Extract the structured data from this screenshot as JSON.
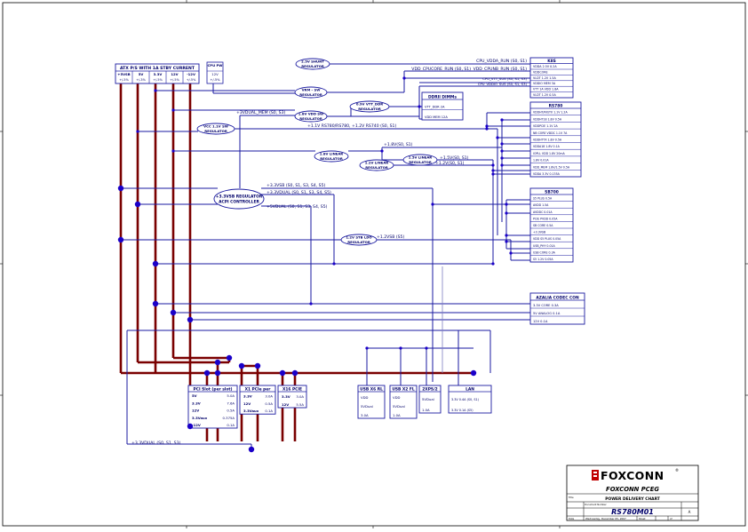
{
  "sheet": {
    "company_name": "FOXCONN",
    "division": "FOXCONN PCEG",
    "title": "POWER DELIVERY CHART",
    "model": "RS780M01",
    "date_text": "Wednesday, December 05, 2007",
    "size_code": "A",
    "label_title": "Title",
    "label_doc": "Document Number",
    "label_date": "Date",
    "label_sheet": "Sheet",
    "label_of": "of"
  },
  "atx": {
    "title": "ATX P/S WITH 1A STBY CURRENT",
    "cols": [
      {
        "name": "+5VSB",
        "tol": "+/-5%"
      },
      {
        "name": "5V",
        "tol": "+/-3%"
      },
      {
        "name": "3.3V",
        "tol": "+/-5%"
      },
      {
        "name": "12V",
        "tol": "+/-5%"
      },
      {
        "name": "-12V",
        "tol": "+/-5%"
      }
    ]
  },
  "cpu_pw": {
    "label": "CPU PW",
    "volt": "12V",
    "tol": "+/-5%"
  },
  "blocks": {
    "shunt": [
      "2.5V SHUNT",
      "REGULATOR"
    ],
    "vrm": [
      "VRM - SW",
      "REGULATOR"
    ],
    "vddr": [
      "1.8V VDD SW",
      "REGULATOR"
    ],
    "vtt": [
      "0.9V VTT_DDR",
      "REGULATOR"
    ],
    "ldo11": [
      "VCC 1.1V SW",
      "REGULATOR"
    ],
    "ldo12a": [
      "1.8V LINEAR",
      "REGULATOR"
    ],
    "ldo12b": [
      "1.2V LINEAR",
      "REGULATOR"
    ],
    "ldo15": [
      "1.5V LINEAR",
      "REGULATOR"
    ],
    "acpi": [
      "+3.3VSB REGULATOR",
      "ACPI CONTROLLER"
    ],
    "stbldo": [
      "1.2V STB LDO",
      "REGULATOR"
    ]
  },
  "ddr": {
    "title": "DDRII DIMMs",
    "rows": [
      "VTT_DDR 2A",
      "VDD MEM 12A"
    ]
  },
  "k8": {
    "title": "K8S",
    "rows": [
      "VDDA 2.5V 0.2A",
      "VDDCORE",
      "VLDT 1.2V 1.5A",
      "VDDIO MEM 3A",
      "VTT 1A VDD 1.8A",
      "VLDT 1.2V 0.5A"
    ]
  },
  "rs780": {
    "title": "RS780",
    "rows": [
      "VDDHT/RX/TX 1.1V 1.2A",
      "VDDHT18 1.8V 0.5A",
      "VDDPCIE 1.1V 2A",
      "NB CORE VDDC 1.1V 7A",
      "VDDHTTX 1.8V 0.5A",
      "VDDA18 1.8V 0.1A",
      "IOPLL VDD 1.8V 20mA",
      "1.8V 0.01A",
      "VDD_MEM 1.8V/1.5V 0.5A",
      "VDDA 3.3V 0.135A"
    ]
  },
  "sb700": {
    "title": "SB700",
    "rows": [
      "S5 PLUS 0.5A",
      "AVDD 1.5A",
      "AVDDC 0.01A",
      "PCIE PVDD 0.05A",
      "SB CORE 0.5A",
      "+3.3VSB",
      "VDD S5 PLUS 0.05A",
      "USB_PHY 0.01A",
      "USB CORE 0.3A",
      "S5 1.2V 0.05A"
    ]
  },
  "azalia": {
    "title": "AZALIA CODEC CON",
    "rows": [
      "3.3V CORE 0.3A",
      "5V ANALOG 0.1A",
      "12V 0.1A"
    ]
  },
  "nets": {
    "cpu_vdda": "CPU_VDDA_RUN (S0, S1)",
    "cpu_core": "VDD_CPUCORE_RUN (S0, S1)",
    "cpu_nb": "VDD_CPUNB_RUN (S0, S1)",
    "cpu_vtt": "CPU_VTT_SUS (S0, S1, S3)",
    "cpu_vddio": "CPU_VDDIO_SUS (S0, S1, S3)",
    "dual_mem": "+3VDUAL_MEM (S0, S3)",
    "rs_11": "+1.1V RS780/RS780, +1.2V RS740 (S0, S1)",
    "v18": "+1.8V(S0, S1)",
    "v15": "+1.5V(S0, S1)",
    "v12": "+1.2V(S0, S1)",
    "v33sb": "+3.3VSB (S0, S1, S3, S4, S5)",
    "v33dual": "+3.3VDUAL (S0, S1, S3, S4, S5)",
    "v5dual": "+5VDUAL (S0, S1, S3, S4, S5)",
    "v12sb": "+1.2VSB (S5)",
    "v33dual_low": "+3.3VDUAL (S0, S1, S3)"
  },
  "slots": {
    "pci": {
      "title": "PCI Slot (per slot)",
      "rows": [
        [
          "5V",
          "5.0A"
        ],
        [
          "3.3V",
          "7.6A"
        ],
        [
          "12V",
          "0.5A"
        ],
        [
          "3.3Vaux",
          "0.375A"
        ],
        [
          "-12V",
          "0.1A"
        ]
      ]
    },
    "x1": {
      "title": "X1 PCIe per",
      "rows": [
        [
          "3.3V",
          "3.0A"
        ],
        [
          "12V",
          "0.5A"
        ],
        [
          "3.3Vaux",
          "0.1A"
        ]
      ]
    },
    "x16": {
      "title": "X16 PCIE",
      "rows": [
        [
          "3.3V",
          "3.0A"
        ],
        [
          "12V",
          "5.5A"
        ]
      ]
    },
    "usbrl": {
      "title": "USB X6 RL",
      "rows": [
        "VDD",
        "5VDual",
        "3.0A"
      ]
    },
    "usbx2": {
      "title": "USB X2 FL",
      "rows": [
        "VDD",
        "5VDual",
        "1.0A"
      ]
    },
    "ps2": {
      "title": "2XPS/2",
      "rows": [
        "5VDual",
        "1.0A"
      ]
    },
    "lan": {
      "title": "LAN",
      "rows": [
        "3.3V 0.4A (S0, S1)",
        "3.3V 0.1A (S5)"
      ]
    }
  }
}
